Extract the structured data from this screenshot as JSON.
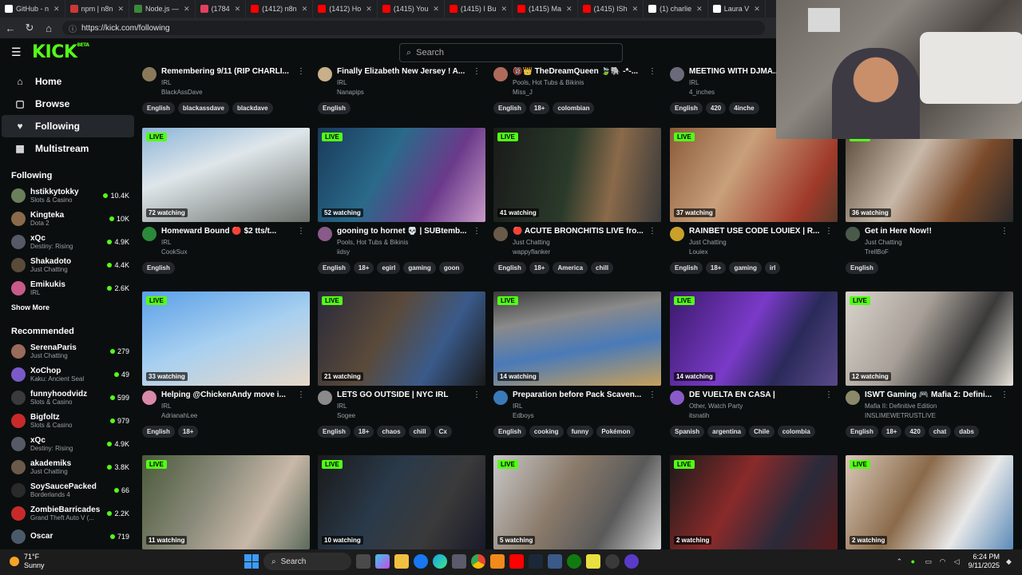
{
  "browser": {
    "tabs": [
      {
        "label": "GitHub - n",
        "color": "#ffffff"
      },
      {
        "label": "npm | n8n",
        "color": "#cb3837"
      },
      {
        "label": "Node.js —",
        "color": "#3c873a"
      },
      {
        "label": "(1784",
        "color": "#e4405f"
      },
      {
        "label": "(1412) n8n",
        "color": "#ff0000"
      },
      {
        "label": "(1412) Ho",
        "color": "#ff0000"
      },
      {
        "label": "(1415) You",
        "color": "#ff0000"
      },
      {
        "label": "(1415) I Bu",
        "color": "#ff0000"
      },
      {
        "label": "(1415) Ma",
        "color": "#ff0000"
      },
      {
        "label": "(1415) ISh",
        "color": "#ff0000"
      },
      {
        "label": "(1) charlie",
        "color": "#ffffff"
      },
      {
        "label": "Laura V",
        "color": "#ffffff"
      }
    ],
    "url": "https://kick.com/following"
  },
  "app": {
    "logo": "KICK",
    "logo_sup": "BETA",
    "search_placeholder": "Search",
    "nav": [
      {
        "label": "Home",
        "icon": "home-icon",
        "glyph": "⌂"
      },
      {
        "label": "Browse",
        "icon": "browse-icon",
        "glyph": "▢"
      },
      {
        "label": "Following",
        "icon": "heart-icon",
        "glyph": "♥"
      },
      {
        "label": "Multistream",
        "icon": "grid-icon",
        "glyph": "▦"
      }
    ],
    "following_title": "Following",
    "following": [
      {
        "name": "hstikkytokky",
        "category": "Slots & Casino",
        "viewers": "10.4K",
        "color": "#6a7f5a"
      },
      {
        "name": "Kingteka",
        "category": "Dota 2",
        "viewers": "10K",
        "color": "#8a6a4a"
      },
      {
        "name": "xQc",
        "category": "Destiny: Rising",
        "viewers": "4.9K",
        "color": "#555a66"
      },
      {
        "name": "Shakadoto",
        "category": "Just Chatting",
        "viewers": "4.4K",
        "color": "#5a4a3a"
      },
      {
        "name": "Emikukis",
        "category": "IRL",
        "viewers": "2.6K",
        "color": "#c85a8a"
      }
    ],
    "show_more": "Show More",
    "recommended_title": "Recommended",
    "recommended": [
      {
        "name": "SerenaParis",
        "category": "Just Chatting",
        "viewers": "279",
        "color": "#9a6a5a"
      },
      {
        "name": "XoChop",
        "category": "Kaku: Ancient Seal",
        "viewers": "49",
        "color": "#7a5ac8"
      },
      {
        "name": "funnyhoodvidz",
        "category": "Slots & Casino",
        "viewers": "599",
        "color": "#3a3a3a"
      },
      {
        "name": "Bigfoltz",
        "category": "Slots & Casino",
        "viewers": "979",
        "color": "#c82a2a"
      },
      {
        "name": "xQc",
        "category": "Destiny: Rising",
        "viewers": "4.9K",
        "color": "#555a66"
      },
      {
        "name": "akademiks",
        "category": "Just Chatting",
        "viewers": "3.8K",
        "color": "#6a5a4a"
      },
      {
        "name": "SoySaucePacked",
        "category": "Borderlands 4",
        "viewers": "66",
        "color": "#2a2a2a"
      },
      {
        "name": "ZombieBarricades",
        "category": "Grand Theft Auto V (...",
        "viewers": "2.2K",
        "color": "#c82a2a"
      },
      {
        "name": "Oscar",
        "category": "",
        "viewers": "719",
        "color": "#4a5a6a"
      }
    ]
  },
  "streams_top": [
    {
      "title": "Remembering 9/11 (RIP CHARLI...",
      "category": "IRL",
      "user": "BlackAssDave",
      "tags": [
        "English",
        "blackassdave",
        "blackdave"
      ],
      "color": "#8a7a5a"
    },
    {
      "title": "Finally Elizabeth New Jersey ! A...",
      "category": "IRL",
      "user": "Nanapips",
      "tags": [
        "English"
      ],
      "color": "#c8b08a"
    },
    {
      "title": "🔞👑 TheDreamQueen 🍃🐘 -*-...",
      "category": "Pools, Hot Tubs & Bikinis",
      "user": "Miss_J",
      "tags": [
        "English",
        "18+",
        "colombian"
      ],
      "color": "#b06a5a"
    },
    {
      "title": "MEETING WITH DJMA...",
      "category": "IRL",
      "user": "4_inches",
      "tags": [
        "English",
        "420",
        "4inche"
      ],
      "color": "#6a6a7a"
    }
  ],
  "streams": [
    {
      "title": "Homeward Bound 🔴 $2 tts/t...",
      "category": "IRL",
      "user": "CookSux",
      "viewers": "72 watching",
      "tags": [
        "English"
      ],
      "thumb": "linear-gradient(160deg,#8ab4d8 0%,#dfe6ea 40%,#6a6f6a 100%)",
      "avatar": "#2a8a3a"
    },
    {
      "title": "gooning to hornet 💀 | SUBtemb...",
      "category": "Pools, Hot Tubs & Bikinis",
      "user": "iidsy",
      "viewers": "52 watching",
      "tags": [
        "English",
        "18+",
        "egirl",
        "gaming",
        "goon"
      ],
      "thumb": "linear-gradient(120deg,#1a3a5a 0%,#2a6a8a 40%,#6a3a8a 70%,#c89ac8 100%)",
      "avatar": "#8a5a8a"
    },
    {
      "title": "🔴 ACUTE BRONCHITIS LIVE fro...",
      "category": "Just Chatting",
      "user": "wappyflanker",
      "viewers": "41 watching",
      "tags": [
        "English",
        "18+",
        "America",
        "chill"
      ],
      "thumb": "linear-gradient(100deg,#1a1a1a 0%,#2a3a2a 45%,#8a6a4a 70%,#3a3a3a 100%)",
      "avatar": "#6a5a4a"
    },
    {
      "title": "RAINBET USE CODE LOUIEX | R...",
      "category": "Just Chatting",
      "user": "Louiex",
      "viewers": "37 watching",
      "tags": [
        "English",
        "18+",
        "gaming",
        "irl"
      ],
      "thumb": "linear-gradient(120deg,#8a5a3a 0%,#c8a07a 40%,#a03a2a 80%,#5a3a2a 100%)",
      "avatar": "#c8a02a"
    },
    {
      "title": "Get in Here Now!!",
      "category": "Just Chatting",
      "user": "TrellBoF",
      "viewers": "36 watching",
      "tags": [
        "English"
      ],
      "thumb": "linear-gradient(120deg,#5a4a3a 0%,#c8b8a8 40%,#7a4a2a 70%,#2a2a2a 100%)",
      "avatar": "#4a5a4a"
    },
    {
      "title": "Helping @ChickenAndy move i...",
      "category": "IRL",
      "user": "AdrianahLee",
      "viewers": "33 watching",
      "tags": [
        "English",
        "18+"
      ],
      "thumb": "linear-gradient(160deg,#5aa0e8 0%,#a8d0f0 50%,#e8d8c8 100%)",
      "avatar": "#d88aa8"
    },
    {
      "title": "LETS GO OUTSIDE | NYC IRL",
      "category": "IRL",
      "user": "Sogee",
      "viewers": "21 watching",
      "tags": [
        "English",
        "18+",
        "chaos",
        "chill",
        "Cx"
      ],
      "thumb": "linear-gradient(120deg,#2a2a3a 0%,#5a4a3a 40%,#3a5a8a 70%,#1a1a1a 100%)",
      "avatar": "#8a8a8a"
    },
    {
      "title": "Preparation before Pack Scaven...",
      "category": "IRL",
      "user": "Edboys",
      "viewers": "14 watching",
      "tags": [
        "English",
        "cooking",
        "funny",
        "Pokémon"
      ],
      "thumb": "linear-gradient(170deg,#3a3a3a 0%,#8a8a8a 30%,#4a7ab8 60%,#c8a05a 100%)",
      "avatar": "#3a7ab8"
    },
    {
      "title": "DE VUELTA EN CASA |",
      "category": "Other, Watch Party",
      "user": "itsnatih",
      "viewers": "14 watching",
      "tags": [
        "Spanish",
        "argentina",
        "Chile",
        "colombia"
      ],
      "thumb": "linear-gradient(120deg,#3a1a6a 0%,#7a3ac8 45%,#2a2a5a 70%,#5a4a8a 100%)",
      "avatar": "#8a5ac8"
    },
    {
      "title": "ISWT Gaming 🎮 Mafia 2: Defini...",
      "category": "Mafia II: Definitive Edition",
      "user": "INSLIMEWETRUSTLIVE",
      "viewers": "12 watching",
      "tags": [
        "English",
        "18+",
        "420",
        "chat",
        "dabs"
      ],
      "thumb": "linear-gradient(120deg,#d8d4cc 0%,#a8a098 40%,#3a3a3a 70%,#e8e4dc 100%)",
      "avatar": "#8a8a6a"
    },
    {
      "title": "",
      "category": "",
      "user": "",
      "viewers": "11 watching",
      "tags": [],
      "thumb": "linear-gradient(120deg,#4a5a3a 0%,#8a8a7a 40%,#c8b8a8 70%,#5a6a5a 100%)",
      "avatar": "#555"
    },
    {
      "title": "",
      "category": "",
      "user": "",
      "viewers": "10 watching",
      "tags": [],
      "thumb": "linear-gradient(120deg,#1a1a1a 0%,#2a3a4a 40%,#3a3a3a 70%,#1a1a2a 100%)",
      "avatar": "#555"
    },
    {
      "title": "",
      "category": "",
      "user": "",
      "viewers": "5 watching",
      "tags": [],
      "thumb": "linear-gradient(120deg,#c8c8c8 0%,#8a7a6a 40%,#5a5a5a 70%,#d8d8d8 100%)",
      "avatar": "#555"
    },
    {
      "title": "",
      "category": "",
      "user": "",
      "viewers": "2 watching",
      "tags": [],
      "thumb": "linear-gradient(120deg,#1a1a1a 0%,#8a2a2a 40%,#2a2a3a 70%,#5a1a1a 100%)",
      "avatar": "#555"
    },
    {
      "title": "",
      "category": "",
      "user": "",
      "viewers": "2 watching",
      "tags": [],
      "thumb": "linear-gradient(120deg,#d8c8b8 0%,#8a6a4a 40%,#e8e8e8 70%,#5a8ab8 100%)",
      "avatar": "#555"
    }
  ],
  "live_label": "LIVE",
  "taskbar": {
    "weather_temp": "71°F",
    "weather_cond": "Sunny",
    "search_label": "Search",
    "time": "6:24 PM",
    "date": "9/11/2025"
  }
}
